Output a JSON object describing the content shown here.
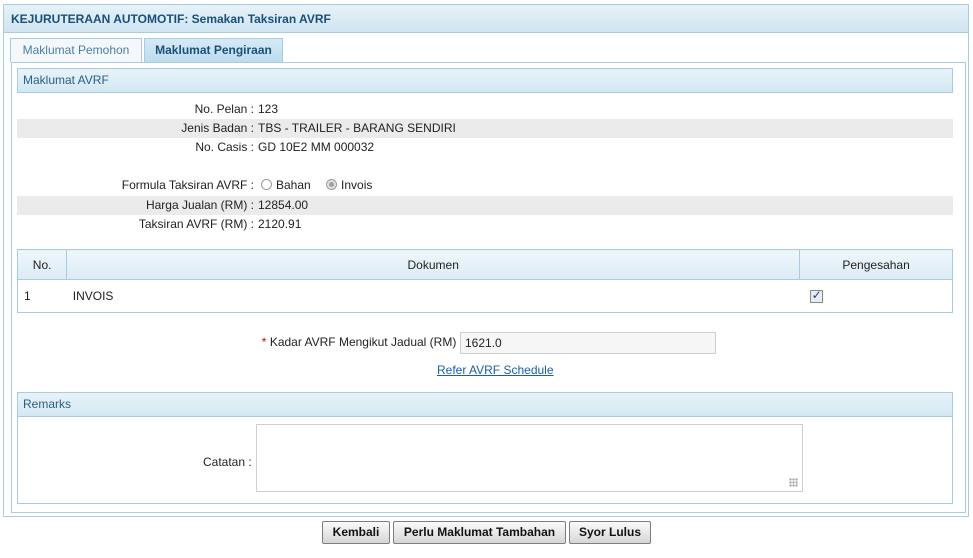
{
  "window": {
    "title": "KEJURUTERAAN AUTOMOTIF: Semakan Taksiran AVRF"
  },
  "tabs": [
    {
      "label": "Maklumat Pemohon",
      "active": false
    },
    {
      "label": "Maklumat Pengiraan",
      "active": true
    }
  ],
  "avrf": {
    "section_title": "Maklumat AVRF",
    "no_pelan_label": "No. Pelan :",
    "no_pelan_value": "123",
    "jenis_badan_label": "Jenis Badan :",
    "jenis_badan_value": "TBS - TRAILER - BARANG SENDIRI",
    "no_casis_label": "No. Casis :",
    "no_casis_value": "GD 10E2 MM 000032",
    "formula_label": "Formula Taksiran AVRF :",
    "formula_options": [
      {
        "label": "Bahan",
        "checked": false
      },
      {
        "label": "Invois",
        "checked": true
      }
    ],
    "harga_label": "Harga Jualan (RM) :",
    "harga_value": "12854.00",
    "taksiran_label": "Taksiran AVRF (RM) :",
    "taksiran_value": "2120.91"
  },
  "doc_table": {
    "headers": [
      "No.",
      "Dokumen",
      "Pengesahan"
    ],
    "rows": [
      {
        "no": "1",
        "dokumen": "INVOIS",
        "pengesahan": true
      }
    ]
  },
  "kadar": {
    "required_mark": "*",
    "label": "Kadar AVRF Mengikut Jadual (RM) :",
    "value": "1621.0",
    "link_text": "Refer AVRF Schedule"
  },
  "remarks": {
    "section_title": "Remarks",
    "catatan_label": "Catatan :",
    "catatan_value": ""
  },
  "buttons": {
    "kembali": "Kembali",
    "perlu": "Perlu Maklumat Tambahan",
    "syor": "Syor Lulus"
  },
  "colors": {
    "accent_border": "#a8cde0",
    "title_text": "#1a4f7a",
    "link": "#1b5fa6",
    "required": "#dd0000"
  }
}
